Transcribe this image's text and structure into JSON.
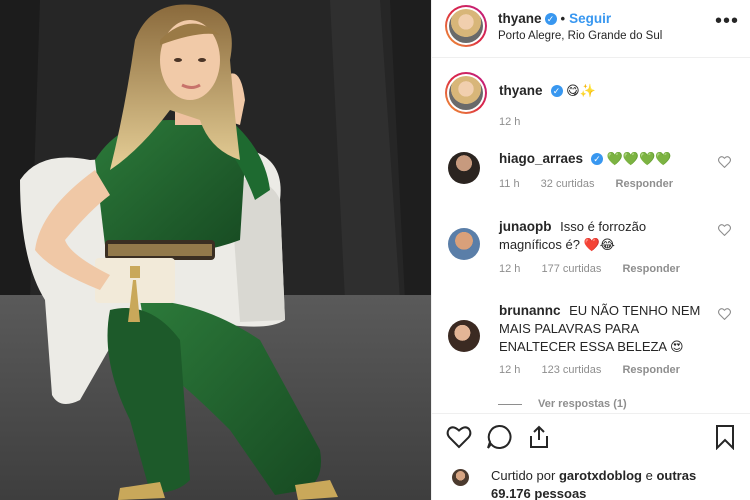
{
  "header": {
    "username": "thyane",
    "follow_label": "Seguir",
    "dot": "•",
    "location": "Porto Alegre, Rio Grande do Sul",
    "more": "•••"
  },
  "caption": {
    "username": "thyane",
    "text": "😋✨",
    "time": "12 h"
  },
  "comments": [
    {
      "username": "hiago_arraes",
      "verified": true,
      "text": "💚💚💚💚",
      "time": "11 h",
      "likes": "32 curtidas",
      "reply": "Responder"
    },
    {
      "username": "junaopb",
      "verified": false,
      "text": "Isso é forrozão magníficos é? ❤️😂",
      "time": "12 h",
      "likes": "177 curtidas",
      "reply": "Responder"
    },
    {
      "username": "brunannc",
      "verified": false,
      "text": "EU NÃO TENHO NEM MAIS PALAVRAS PARA ENALTECER ESSA BELEZA 😍",
      "time": "12 h",
      "likes": "123 curtidas",
      "reply": "Responder"
    }
  ],
  "view_replies": "Ver respostas (1)",
  "likes": {
    "liked_by_label": "Curtido por",
    "liked_by_user": "garotxdoblog",
    "and_label": "e",
    "others": "outras 69.176 pessoas"
  },
  "icons": [
    "heart-icon",
    "comment-icon",
    "share-icon",
    "bookmark-icon",
    "verified-badge-icon",
    "more-options-icon"
  ],
  "colors": {
    "link_blue": "#3897f0",
    "text": "#262626",
    "muted": "#8e8e8e",
    "dress_green": "#1f5c2c"
  }
}
